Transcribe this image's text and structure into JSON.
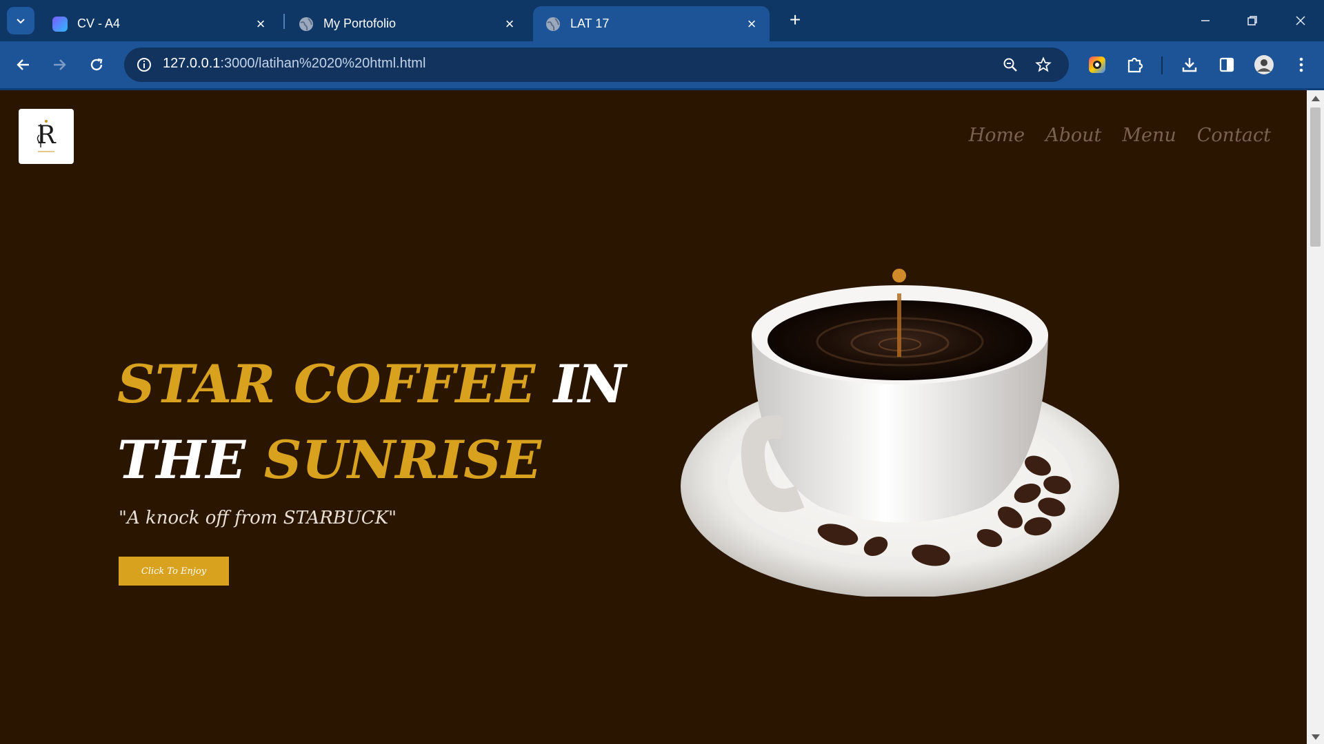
{
  "browser": {
    "tabs": [
      {
        "title": "CV - A4",
        "active": false
      },
      {
        "title": "My Portofolio",
        "active": false
      },
      {
        "title": "LAT 17",
        "active": true
      }
    ],
    "url_host": "127.0.0.1",
    "url_rest": ":3000/latihan%2020%20html.html"
  },
  "site": {
    "nav": [
      "Home",
      "About",
      "Menu",
      "Contact"
    ],
    "hero": {
      "line1_gold": "STAR COFFEE",
      "line1_white": "IN",
      "line2_white": "THE",
      "line2_gold": "SUNRISE"
    },
    "tagline": "\"A knock off from STARBUCK\"",
    "cta": "Click To Enjoy"
  },
  "colors": {
    "accent_gold": "#d8a21f",
    "page_bg": "#2a1600",
    "nav_text": "#7a6250",
    "browser_frame": "#0e3765",
    "browser_toolbar": "#1d5498"
  },
  "icons": [
    "tab-search-icon",
    "tab-favicon",
    "globe-icon",
    "close-icon",
    "plus-icon",
    "minimize-icon",
    "restore-icon",
    "back-arrow-icon",
    "forward-arrow-icon",
    "reload-icon",
    "site-info-icon",
    "zoom-icon",
    "star-icon",
    "color-picker-extension-icon",
    "puzzle-extensions-icon",
    "download-icon",
    "side-panel-icon",
    "profile-avatar",
    "more-vert-icon"
  ]
}
